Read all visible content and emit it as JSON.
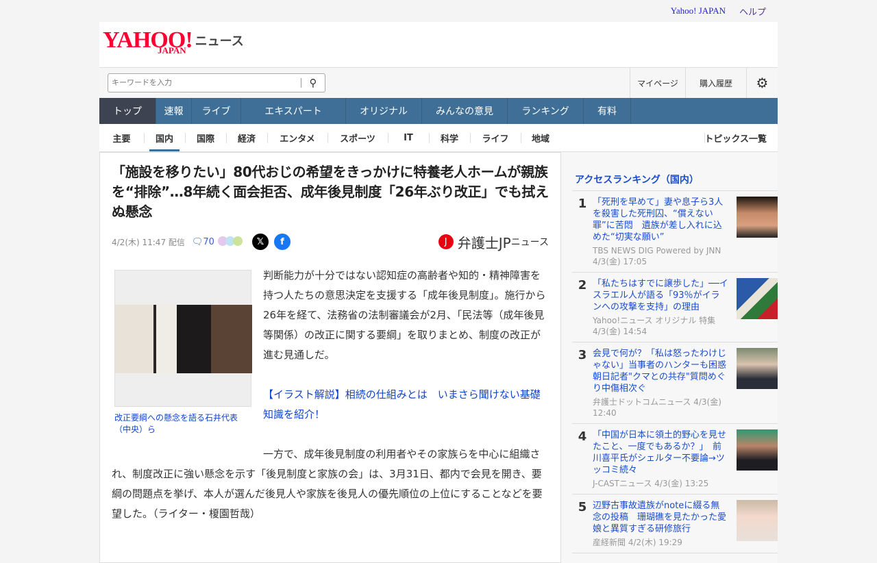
{
  "topbar": {
    "yahoo": "Yahoo! JAPAN",
    "help": "ヘルプ"
  },
  "logo": {
    "yahoo": "YAHOO!",
    "japan": "JAPAN",
    "news": "ニュース"
  },
  "search": {
    "placeholder": "キーワードを入力"
  },
  "header_links": {
    "mypage": "マイページ",
    "history": "購入履歴"
  },
  "gnav": [
    "トップ",
    "速報",
    "ライブ",
    "エキスパート",
    "オリジナル",
    "みんなの意見",
    "ランキング",
    "有料"
  ],
  "snav": [
    "主要",
    "国内",
    "国際",
    "経済",
    "エンタメ",
    "スポーツ",
    "IT",
    "科学",
    "ライフ",
    "地域"
  ],
  "snav_all": "トピックス一覧",
  "article": {
    "title": "「施設を移りたい」80代おじの希望をきっかけに特養老人ホームが親族を“排除”…8年続く面会拒否、成年後見制度「26年ぶり改正」でも拭えぬ懸念",
    "date": "4/2(木) 11:47 配信",
    "comments": "70",
    "publisher": "弁護士JP",
    "publisher_suffix": "ニュース",
    "caption": "改正要綱への懸念を語る石井代表（中央）ら",
    "p1": "判断能力が十分ではない認知症の高齢者や知的・精神障害を持つ人たちの意思決定を支援する「成年後見制度」。施行から26年を経て、法務省の法制審議会が2月、「民法等（成年後見等関係）の改正に関する要綱」を取りまとめ、制度の改正が進む見通しだ。",
    "link": "【イラスト解説】相続の仕組みとは　いまさら聞けない基礎知識を紹介！",
    "p2": "一方で、成年後見制度の利用者やその家族らを中心に組織され、制度改正に強い懸念を示す「後見制度と家族の会」は、3月31日、都内で会見を開き、要綱の問題点を挙げ、本人が選んだ後見人や家族を後見人の優先順位の上位にすることなどを要望した。（ライター・榎園哲哉）"
  },
  "ranking": {
    "title": "アクセスランキング（国内）",
    "items": [
      {
        "rank": "1",
        "title": "「死刑を早めて」妻や息子ら3人を殺害した死刑囚、“償えない罪”に苦悶　遺族が差し入れに込めた“切実な願い”",
        "source": "TBS NEWS DIG Powered by JNN",
        "time": "4/3(金) 17:05"
      },
      {
        "rank": "2",
        "title": "「私たちはすでに譲歩した」──イスラエル人が語る「93％がイランへの攻撃を支持」の理由",
        "source": "Yahoo!ニュース オリジナル 特集",
        "time": "4/3(金) 14:54"
      },
      {
        "rank": "3",
        "title": "会見で何が？「私は怒ったわけじゃない」当事者のハンターも困惑　朝日記者\"クマとの共存\"質問めぐり中傷相次ぐ",
        "source": "弁護士ドットコムニュース",
        "time": "4/3(金) 12:40"
      },
      {
        "rank": "4",
        "title": "「中国が日本に領土的野心を見せたこと、一度でもあるか？」　前川喜平氏がシェルター不要論→ツッコミ続々",
        "source": "J-CASTニュース",
        "time": "4/3(金) 13:25"
      },
      {
        "rank": "5",
        "title": "辺野古事故遺族がnoteに綴る無念の投稿　珊瑚礁を見たかった愛娘と異質すぎる研修旅行",
        "source": "産経新聞",
        "time": "4/2(木) 19:29"
      }
    ]
  }
}
